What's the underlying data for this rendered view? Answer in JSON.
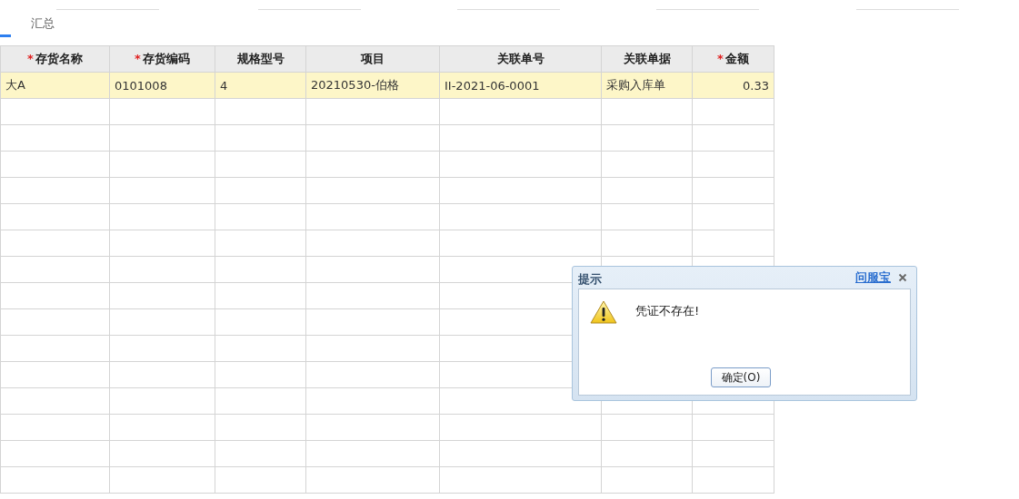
{
  "tabs": [
    {
      "selected": true
    },
    {
      "label": "汇总",
      "selected": false
    }
  ],
  "table": {
    "columns": [
      {
        "label": "存货名称",
        "required_mark": "*"
      },
      {
        "label": "存货编码",
        "required_mark": "*"
      },
      {
        "label": "规格型号"
      },
      {
        "label": "项目"
      },
      {
        "label": "关联单号"
      },
      {
        "label": "关联单据"
      },
      {
        "label": "金额",
        "required_mark": "*"
      }
    ],
    "rows": [
      {
        "selected": true,
        "cells": [
          "大A",
          "0101008",
          "4",
          "20210530-伯格",
          "II-2021-06-0001",
          "采购入库单",
          "0.33"
        ]
      }
    ]
  },
  "dialog": {
    "title": "提示",
    "help_link": "问服宝",
    "message": "凭证不存在!",
    "ok_button": "确定(O)"
  }
}
